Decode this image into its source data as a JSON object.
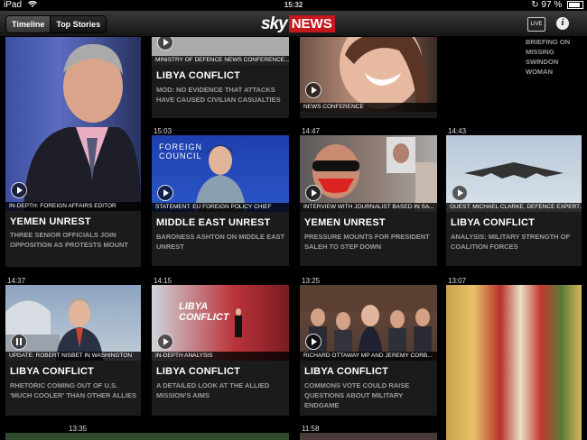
{
  "status": {
    "device": "iPad",
    "time": "15:32",
    "battery": "97 %"
  },
  "nav": {
    "tabs": [
      {
        "label": "Timeline"
      },
      {
        "label": "Top Stories"
      }
    ],
    "logo_sky": "sky",
    "logo_news": "NEWS",
    "live_label": "LIVE",
    "info_label": "i"
  },
  "cards": [
    {
      "time": "",
      "caption": "IN-DEPTH: FOREIGN AFFAIRS EDITOR",
      "headline": "YEMEN UNREST",
      "desc": "THREE SENIOR OFFICIALS JOIN OPPOSITION AS PROTESTS MOUNT"
    },
    {
      "time": "",
      "caption": "MINISTRY OF DEFENCE NEWS CONFERENCE...",
      "headline": "LIBYA CONFLICT",
      "desc": "MOD: NO EVIDENCE THAT ATTACKS HAVE CAUSED CIVILIAN CASUALTIES"
    },
    {
      "time": "",
      "caption": "NEWS CONFERENCE",
      "headline": "",
      "desc": ""
    },
    {
      "time": "",
      "caption": "",
      "headline": "",
      "desc": "BRIEFING ON MISSING SWINDON WOMAN"
    },
    {
      "time": "15:03",
      "caption": "STATEMENT: EU FOREIGN POLICY CHIEF",
      "headline": "MIDDLE EAST UNREST",
      "desc": "BARONESS ASHTON ON MIDDLE EAST UNREST",
      "thumb_text": "FOREIGN COUNCIL"
    },
    {
      "time": "14:47",
      "caption": "INTERVIEW WITH JOURNALIST BASED IN SA...",
      "headline": "YEMEN UNREST",
      "desc": "PRESSURE MOUNTS FOR PRESIDENT SALEH TO STEP DOWN"
    },
    {
      "time": "14:43",
      "caption": "GUEST: MICHAEL CLARKE, DEFENCE EXPERT...",
      "headline": "LIBYA CONFLICT",
      "desc": "ANALYSIS: MILITARY STRENGTH OF COALITION FORCES"
    },
    {
      "time": "14:37",
      "caption": "UPDATE: ROBERT NISBET IN WASHINGTON",
      "headline": "LIBYA CONFLICT",
      "desc": "RHETORIC COMING OUT OF U.S. 'MUCH COOLER' THAN OTHER ALLIES"
    },
    {
      "time": "14:15",
      "caption": "IN-DEPTH ANALYSIS",
      "headline": "LIBYA CONFLICT",
      "desc": "A DETAILED LOOK AT THE ALLIED MISSION'S AIMS",
      "thumb_text": "LIBYA CONFLICT"
    },
    {
      "time": "13:25",
      "caption": "RICHARD OTTAWAY MP AND JEREMY CORB...",
      "headline": "LIBYA CONFLICT",
      "desc": "COMMONS VOTE COULD RAISE QUESTIONS ABOUT MILITARY ENDGAME"
    },
    {
      "time": "13:07",
      "caption": "",
      "headline": "",
      "desc": ""
    },
    {
      "time": "13:35",
      "caption": "",
      "headline": "",
      "desc": ""
    },
    {
      "time": "11:58",
      "caption": "",
      "headline": "",
      "desc": ""
    }
  ]
}
